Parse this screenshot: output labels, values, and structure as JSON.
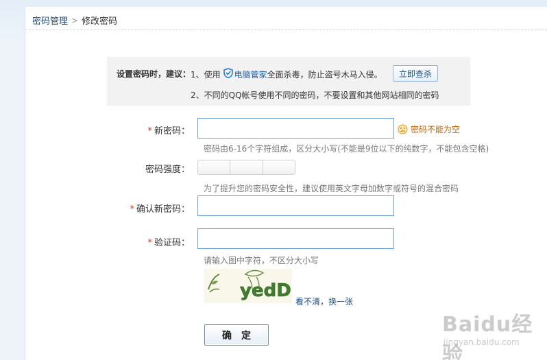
{
  "breadcrumb": {
    "parent": "密码管理",
    "separator": ">",
    "current": "修改密码"
  },
  "tips": {
    "title": "设置密码时，建议：",
    "line1_prefix": "1、使用",
    "brand": "电脑管家",
    "line1_suffix": "全面杀毒，防止盗号木马入侵。",
    "scan_button": "立即查杀",
    "line2": "2、不同的QQ帐号使用不同的密码，不要设置和其他网站相同的密码"
  },
  "form": {
    "new_password": {
      "label": "新密码：",
      "required_mark": "*",
      "value": "",
      "error": "密码不能为空",
      "hint": "密码由6-16个字符组成，区分大小写(不能是9位以下的纯数字，不能包含空格)"
    },
    "strength": {
      "label": "密码强度：",
      "hint": "为了提升您的密码安全性，建议使用英文字母加数字或符号的混合密码"
    },
    "confirm_password": {
      "label": "确认新密码：",
      "required_mark": "*",
      "value": ""
    },
    "captcha": {
      "label": "验证码：",
      "required_mark": "*",
      "value": "",
      "hint": "请输入图中字符，不区分大小写",
      "image_text": "yedD",
      "refresh": "看不清，换一张"
    },
    "submit": "确定"
  },
  "watermark": {
    "logo": "Baidu经验",
    "sub": "jingyan.baidu.com"
  },
  "colors": {
    "link": "#1d4f86",
    "required": "#d93a1b",
    "error": "#c86400",
    "input_border": "#6fa3cf",
    "tip_bg": "#f2f2f2"
  },
  "icons": [
    "chevron-right-icon",
    "shield-icon",
    "sad-face-icon"
  ]
}
